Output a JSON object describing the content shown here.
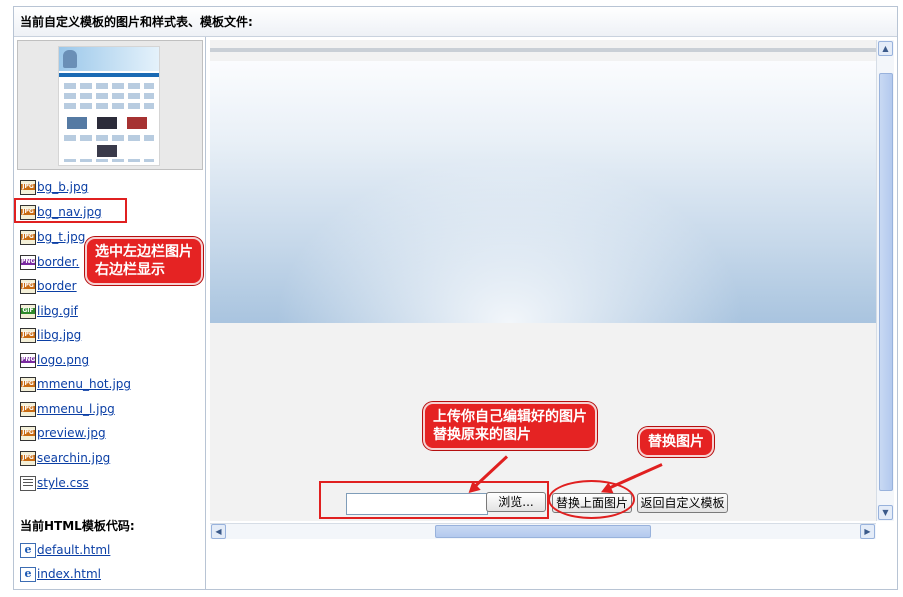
{
  "panel_title": "当前自定义模板的图片和样式表、模板文件:",
  "files": [
    {
      "name": "bg_b.jpg",
      "type": "jpg"
    },
    {
      "name": "bg_nav.jpg",
      "type": "jpg"
    },
    {
      "name": "bg_t.jpg",
      "type": "jpg"
    },
    {
      "name": "border.",
      "type": "png"
    },
    {
      "name": "border",
      "type": "jpg"
    },
    {
      "name": "libg.gif",
      "type": "gif"
    },
    {
      "name": "libg.jpg",
      "type": "jpg"
    },
    {
      "name": "logo.png",
      "type": "png"
    },
    {
      "name": "mmenu_hot.jpg",
      "type": "jpg"
    },
    {
      "name": "mmenu_l.jpg",
      "type": "jpg"
    },
    {
      "name": "preview.jpg",
      "type": "jpg"
    },
    {
      "name": "searchin.jpg",
      "type": "jpg"
    },
    {
      "name": "style.css",
      "type": "css"
    }
  ],
  "html_section_title": "当前HTML模板代码:",
  "html_files": [
    {
      "name": "default.html"
    },
    {
      "name": "index.html"
    }
  ],
  "upload": {
    "file_value": "",
    "browse_label": "浏览...",
    "replace_label": "替换上面图片",
    "back_label": "返回自定义模板"
  },
  "annotations": {
    "left_callout": "选中左边栏图片\n右边栏显示",
    "upload_callout": "上传你自己编辑好的图片\n替换原来的图片",
    "replace_callout": "替换图片"
  },
  "icons": {
    "jpg": "jpg-file-icon",
    "gif": "gif-file-icon",
    "png": "png-file-icon",
    "css": "css-file-icon",
    "html": "html-file-icon"
  },
  "colors": {
    "annotation_red": "#e52323",
    "link_blue": "#0b3fa5"
  }
}
